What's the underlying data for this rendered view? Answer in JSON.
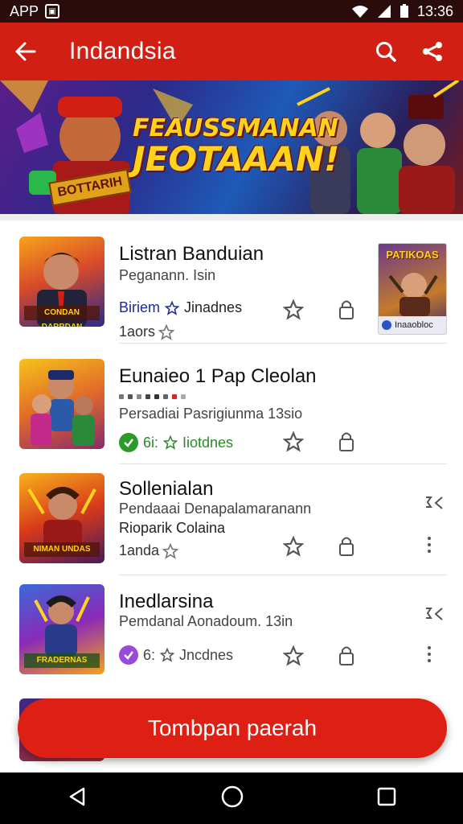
{
  "status_bar": {
    "left_label": "APP",
    "time": "13:36"
  },
  "app_bar": {
    "title": "Indandsia"
  },
  "banner": {
    "line1": "FEAUSSMANAN",
    "line2": "JEOTAAAN!",
    "ribbon": "BOTTARIH"
  },
  "items": [
    {
      "title": "Listran Banduian",
      "subtitle": "Peganann. Isin",
      "meta": "Biriem",
      "meta_tail": "Jinadnes",
      "rating_label": "1aors",
      "thumb_caption": "CONDAN DARRDAN",
      "ad": {
        "title": "PATIKOAS",
        "footer": "Inaaobloc"
      }
    },
    {
      "title": "Eunaieo 1 Pap Cleolan",
      "subtitle": "Persadiai Pasrigiunma 13sio",
      "meta": "6i:",
      "meta_tail": "Iiotdnes",
      "thumb_caption": ""
    },
    {
      "title": "Sollenialan",
      "subtitle": "Pendaaai Denapalamaranann",
      "subtitle2": "Rioparik Colaina",
      "rating_label": "1anda",
      "thumb_caption": "NIMAN UNDAS"
    },
    {
      "title": "Inedlarsina",
      "subtitle": "Pemdanal Aonadoum. 13in",
      "meta": "6:",
      "meta_tail": "Jncdnes",
      "thumb_caption": "FRADERNAS"
    }
  ],
  "fab": {
    "label": "Tombpan paerah"
  },
  "colors": {
    "primary": "#d11f14",
    "status": "#2a0c0c",
    "check_green": "#2a9a2a",
    "check_purple": "#9a4ad8"
  }
}
